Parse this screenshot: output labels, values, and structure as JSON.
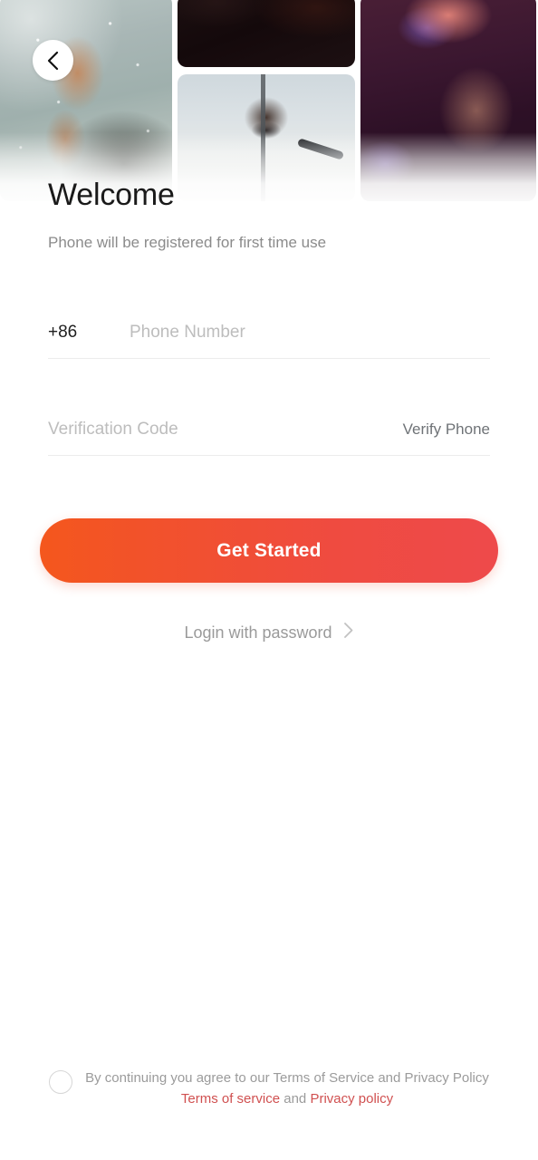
{
  "header": {
    "back_icon": "chevron-left-icon",
    "collage": {
      "left_card": "concert-smoke-photo",
      "mid_top_card": "dark-stage-photo",
      "mid_bottom_card": "singer-sunglasses-photo",
      "right_card": "magenta-concert-photo"
    }
  },
  "page": {
    "title": "Welcome",
    "subtitle": "Phone will be registered for first time use"
  },
  "form": {
    "country_code": "+86",
    "phone_placeholder": "Phone Number",
    "phone_value": "",
    "code_placeholder": "Verification Code",
    "code_value": "",
    "verify_label": "Verify Phone"
  },
  "actions": {
    "primary_label": "Get Started",
    "secondary_label": "Login with password",
    "secondary_icon": "chevron-right-icon"
  },
  "footer": {
    "checkbox_state": "unchecked",
    "agreement_line1": "By continuing you agree to our Terms of Service and Privacy Policy",
    "terms_link": "Terms of service",
    "conjunction": "and",
    "privacy_link": "Privacy policy"
  },
  "colors": {
    "cta_gradient_start": "#F4571D",
    "cta_gradient_end": "#EE4A4B",
    "link_red": "#D05050",
    "title": "#1A1A1A",
    "muted_text": "#9B9B9B",
    "placeholder": "#BDBDBD"
  }
}
